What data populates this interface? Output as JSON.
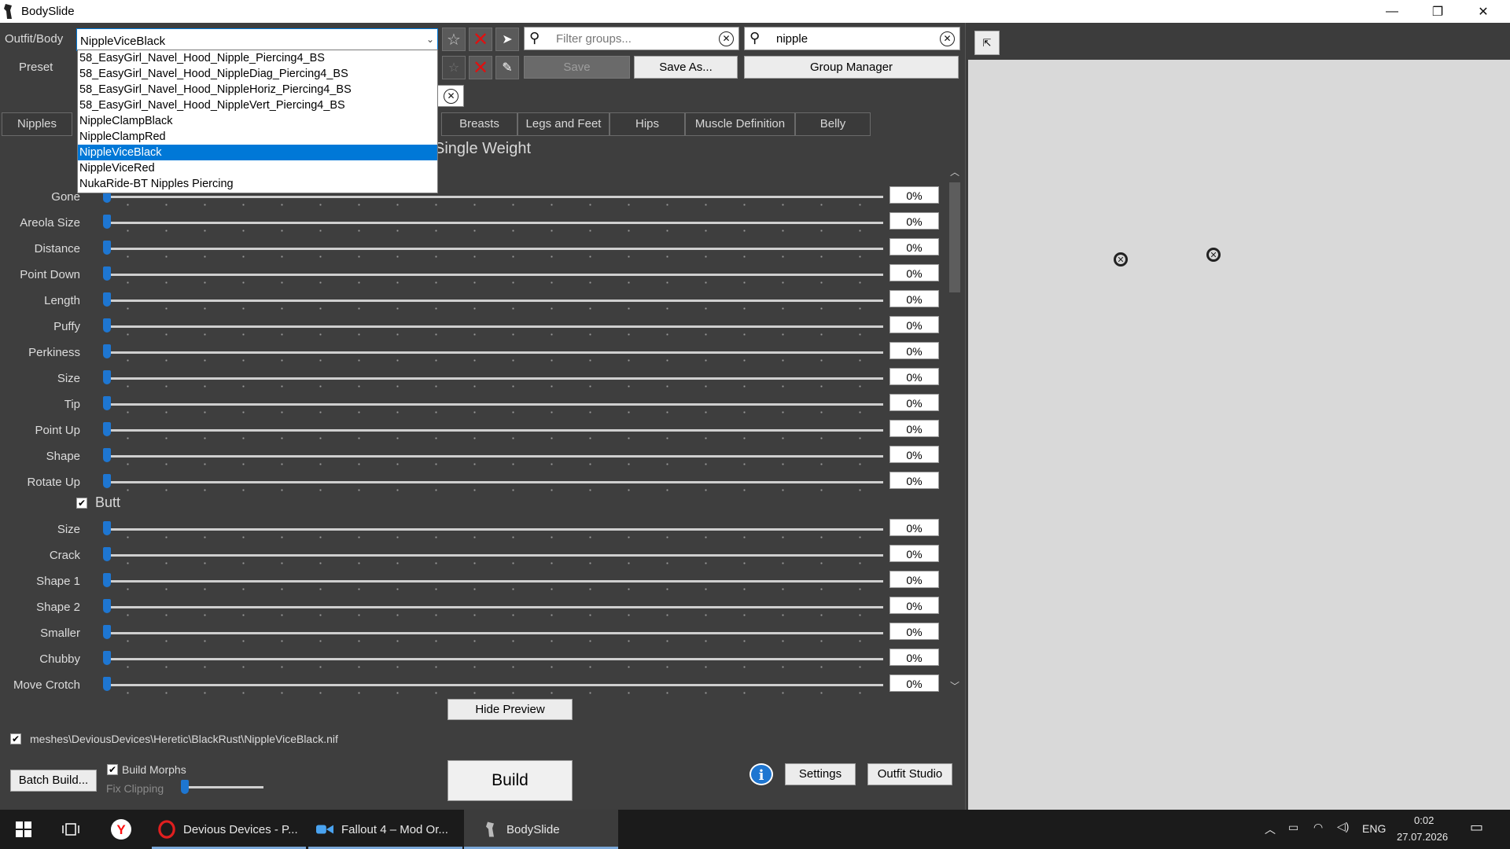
{
  "window": {
    "title": "BodySlide",
    "minimize_glyph": "—",
    "restore_glyph": "❐",
    "close_glyph": "✕"
  },
  "toolbar": {
    "outfit_label": "Outfit/Body",
    "outfit_value": "NippleViceBlack",
    "preset_label": "Preset",
    "group_filter_placeholder": "Filter groups...",
    "outfit_filter_value": "nipple",
    "save_label": "Save",
    "save_as_label": "Save As...",
    "group_manager_label": "Group Manager"
  },
  "dropdown": {
    "items": [
      "58_EasyGirl_Navel_Hood_Nipple_Piercing4_BS",
      "58_EasyGirl_Navel_Hood_NippleDiag_Piercing4_BS",
      "58_EasyGirl_Navel_Hood_NippleHoriz_Piercing4_BS",
      "58_EasyGirl_Navel_Hood_NippleVert_Piercing4_BS",
      "NippleClampBlack",
      "NippleClampRed",
      "NippleViceBlack",
      "NippleViceRed",
      "NukaRide-BT Nipples Piercing"
    ],
    "selected": "NippleViceBlack"
  },
  "tabs": [
    "Nipples",
    "Breasts",
    "Legs and Feet",
    "Hips",
    "Muscle Definition",
    "Belly"
  ],
  "headings": {
    "weight": "Single Weight",
    "butt": "Butt"
  },
  "nipple_sliders": [
    {
      "name": "Gone",
      "value": "0%"
    },
    {
      "name": "Areola Size",
      "value": "0%"
    },
    {
      "name": "Distance",
      "value": "0%"
    },
    {
      "name": "Point Down",
      "value": "0%"
    },
    {
      "name": "Length",
      "value": "0%"
    },
    {
      "name": "Puffy",
      "value": "0%"
    },
    {
      "name": "Perkiness",
      "value": "0%"
    },
    {
      "name": "Size",
      "value": "0%"
    },
    {
      "name": "Tip",
      "value": "0%"
    },
    {
      "name": "Point Up",
      "value": "0%"
    },
    {
      "name": "Shape",
      "value": "0%"
    },
    {
      "name": "Rotate Up",
      "value": "0%"
    }
  ],
  "butt_sliders": [
    {
      "name": "Size",
      "value": "0%"
    },
    {
      "name": "Crack",
      "value": "0%"
    },
    {
      "name": "Shape 1",
      "value": "0%"
    },
    {
      "name": "Shape 2",
      "value": "0%"
    },
    {
      "name": "Smaller",
      "value": "0%"
    },
    {
      "name": "Chubby",
      "value": "0%"
    },
    {
      "name": "Move Crotch",
      "value": "0%"
    }
  ],
  "bottom": {
    "hide_preview_label": "Hide Preview",
    "output_path": "meshes\\DeviousDevices\\Heretic\\BlackRust\\NippleViceBlack.nif",
    "batch_build_label": "Batch Build...",
    "build_morphs_label": "Build Morphs",
    "fix_clipping_label": "Fix Clipping",
    "build_label": "Build",
    "info_label": "i",
    "settings_label": "Settings",
    "outfit_studio_label": "Outfit Studio"
  },
  "taskbar": {
    "items": [
      {
        "label": "Devious Devices - P..."
      },
      {
        "label": "Fallout 4 – Mod Or..."
      },
      {
        "label": "BodySlide"
      }
    ],
    "language": "ENG",
    "time": "0:02",
    "date": "27.07.2026"
  },
  "colors": {
    "accent": "#0078d7",
    "slider_thumb": "#1e76d1",
    "panel_bg": "#3e3e3e",
    "preview_bg": "#d9d9d9",
    "delete_red": "#e01010"
  }
}
